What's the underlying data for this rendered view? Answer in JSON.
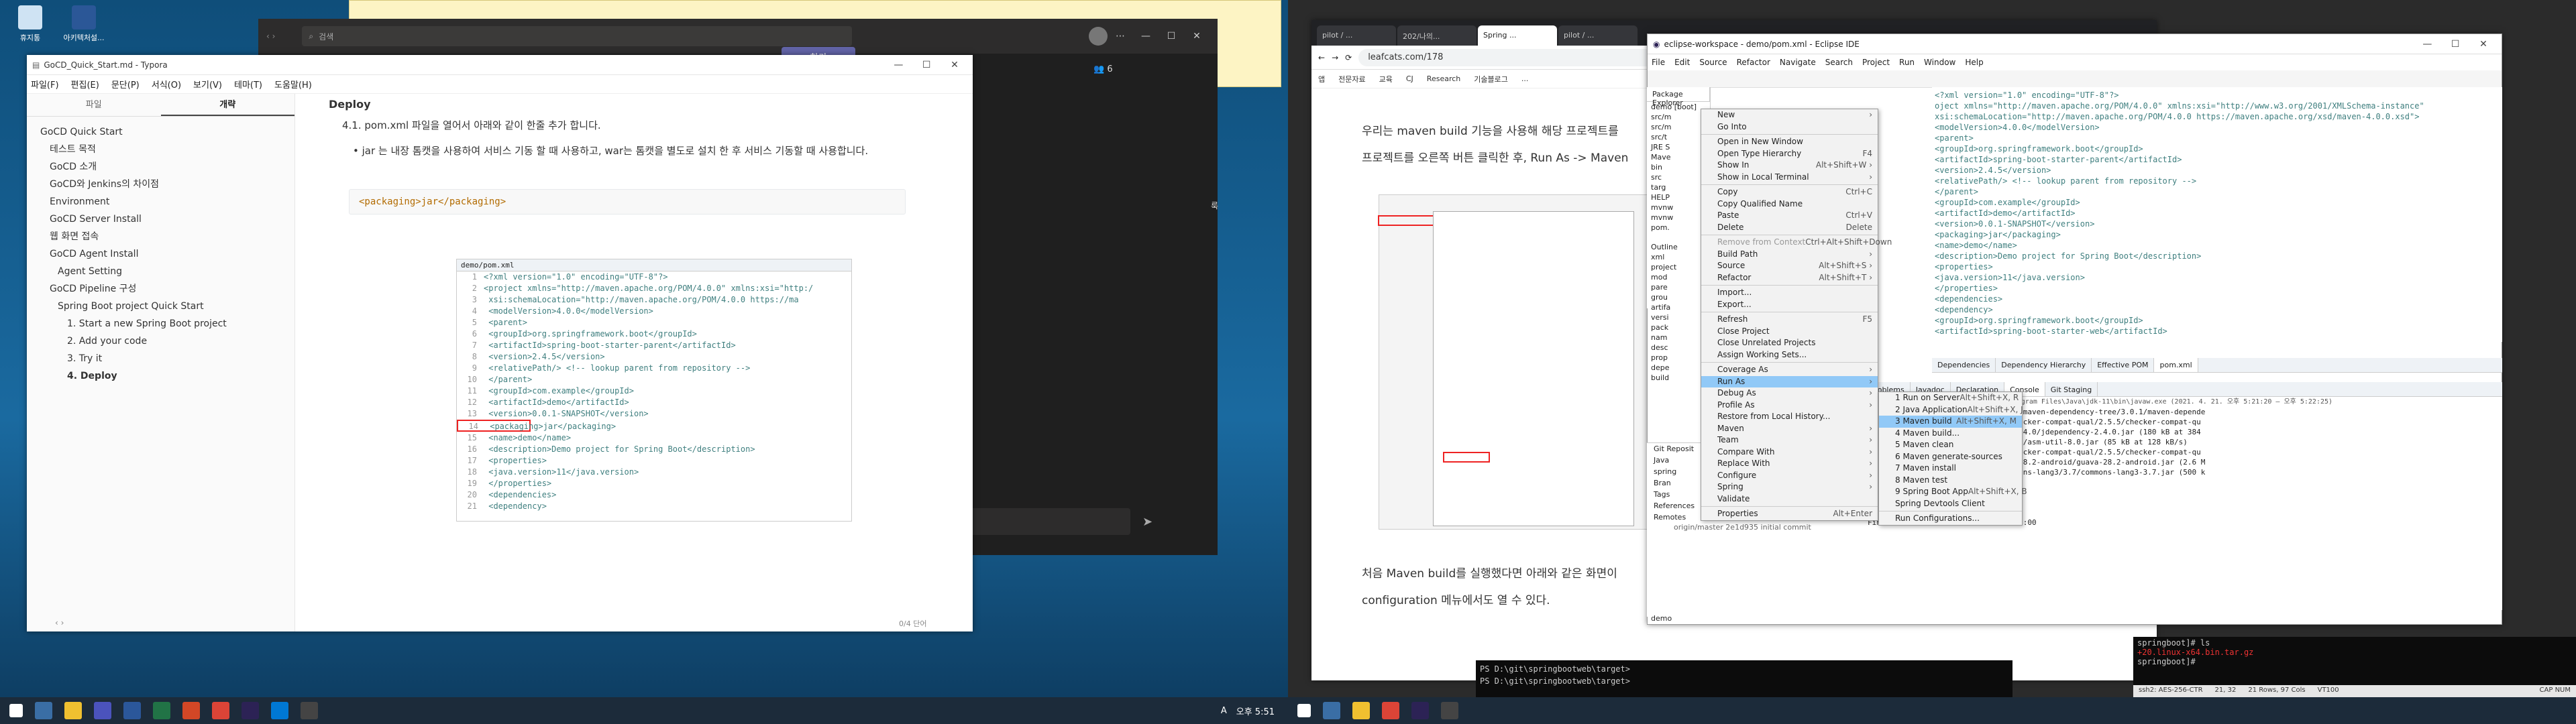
{
  "desktop_icons": [
    {
      "label": "휴지통",
      "icon": "recycle-bin-icon"
    },
    {
      "label": "아키텍처설...",
      "icon": "document-icon"
    }
  ],
  "chat_window": {
    "search_placeholder": "검색",
    "join_button": "참가",
    "participant_count": "6",
    "side_label": "룩"
  },
  "typora": {
    "title": "GoCD_Quick_Start.md - Typora",
    "menu": [
      "파일(F)",
      "편집(E)",
      "문단(P)",
      "서식(O)",
      "보기(V)",
      "테마(T)",
      "도움말(H)"
    ],
    "sidebar_tabs": [
      "파일",
      "개략"
    ],
    "toc": [
      {
        "text": "GoCD Quick Start",
        "level": 1
      },
      {
        "text": "테스트 목적",
        "level": 2
      },
      {
        "text": "GoCD 소개",
        "level": 2
      },
      {
        "text": "GoCD와 Jenkins의 차이점",
        "level": 2
      },
      {
        "text": "Environment",
        "level": 2
      },
      {
        "text": "GoCD Server Install",
        "level": 2
      },
      {
        "text": "웹 화면 접속",
        "level": 2
      },
      {
        "text": "GoCD Agent Install",
        "level": 2
      },
      {
        "text": "Agent Setting",
        "level": 3
      },
      {
        "text": "GoCD Pipeline 구성",
        "level": 2
      },
      {
        "text": "Spring Boot project Quick Start",
        "level": 3
      },
      {
        "text": "1. Start a new Spring Boot project",
        "level": 4
      },
      {
        "text": "2. Add your code",
        "level": 4
      },
      {
        "text": "3. Try it",
        "level": 4
      },
      {
        "text": "4. Deploy",
        "level": 4,
        "bold": true
      }
    ],
    "heading_partial": "Deploy",
    "step_text": "4.1. pom.xml 파일을 열어서 아래와 같이 한줄 추가 합니다.",
    "bullet": "jar 는 내장 톰캣을 사용하여 서비스 기동 할 때 사용하고, war는 톰캣을 별도로 설치 한 후 서비스 기동할 때 사용합니다.",
    "code": "<packaging>jar</packaging>",
    "screenshot_tab": "demo/pom.xml",
    "xml_lines": [
      {
        "n": "1",
        "t": "<?xml version=\"1.0\" encoding=\"UTF-8\"?>"
      },
      {
        "n": "2",
        "t": "<project xmlns=\"http://maven.apache.org/POM/4.0.0\" xmlns:xsi=\"http:/"
      },
      {
        "n": "3",
        "t": "    xsi:schemaLocation=\"http://maven.apache.org/POM/4.0.0 https://ma"
      },
      {
        "n": "4",
        "t": "    <modelVersion>4.0.0</modelVersion>"
      },
      {
        "n": "5",
        "t": "    <parent>"
      },
      {
        "n": "6",
        "t": "        <groupId>org.springframework.boot</groupId>"
      },
      {
        "n": "7",
        "t": "        <artifactId>spring-boot-starter-parent</artifactId>"
      },
      {
        "n": "8",
        "t": "        <version>2.4.5</version>"
      },
      {
        "n": "9",
        "t": "        <relativePath/> <!-- lookup parent from repository -->"
      },
      {
        "n": "10",
        "t": "    </parent>"
      },
      {
        "n": "11",
        "t": "    <groupId>com.example</groupId>"
      },
      {
        "n": "12",
        "t": "    <artifactId>demo</artifactId>"
      },
      {
        "n": "13",
        "t": "    <version>0.0.1-SNAPSHOT</version>"
      },
      {
        "n": "14",
        "t": "    <packaging>jar</packaging>"
      },
      {
        "n": "15",
        "t": "    <name>demo</name>"
      },
      {
        "n": "16",
        "t": "    <description>Demo project for Spring Boot</description>"
      },
      {
        "n": "17",
        "t": "    <properties>"
      },
      {
        "n": "18",
        "t": "        <java.version>11</java.version>"
      },
      {
        "n": "19",
        "t": "    </properties>"
      },
      {
        "n": "20",
        "t": "    <dependencies>"
      },
      {
        "n": "21",
        "t": "        <dependency>"
      }
    ],
    "status_words": "0/4 단어"
  },
  "chrome": {
    "tabs": [
      "pilot / ...",
      "202/나의...",
      "Spring ...",
      "pilot / ..."
    ],
    "url": "leafcats.com/178",
    "bookmarks": [
      "앱",
      "전문자료",
      "교육",
      "CJ",
      "Research",
      "기술블로그",
      "..."
    ],
    "para1": "우리는 maven build 기능을 사용해 해당 프로젝트를",
    "para2": "프로젝트를 오른쪽 버튼 클릭한 후, Run As -> Maven",
    "para3": "처음 Maven build를 실행했다면 아래와 같은 화면이",
    "para4": "configuration 메뉴에서도 열 수 있다."
  },
  "eclipse": {
    "title": "eclipse-workspace - demo/pom.xml - Eclipse IDE",
    "menu": [
      "File",
      "Edit",
      "Source",
      "Refactor",
      "Navigate",
      "Search",
      "Project",
      "Run",
      "Window",
      "Help"
    ],
    "explorer_title": "Package Explorer",
    "explorer_items": [
      "demo [boot]",
      "src/m",
      "src/m",
      "src/t",
      "JRE S",
      "Mave",
      "bin",
      "src",
      "targ",
      "HELP",
      "mvnw",
      "mvnw",
      "pom."
    ],
    "outline_items": [
      "Outline",
      "xml",
      "project",
      "mod",
      "pare",
      "grou",
      "artifa",
      "versi",
      "pack",
      "nam",
      "desc",
      "prop",
      "depe",
      "build"
    ],
    "editor_lines": [
      "<?xml version=\"1.0\" encoding=\"UTF-8\"?>",
      "oject xmlns=\"http://maven.apache.org/POM/4.0.0\" xmlns:xsi=\"http://www.w3.org/2001/XMLSchema-instance\"",
      "xsi:schemaLocation=\"http://maven.apache.org/POM/4.0.0 https://maven.apache.org/xsd/maven-4.0.0.xsd\">",
      "<modelVersion>4.0.0</modelVersion>",
      "<parent>",
      "    <groupId>org.springframework.boot</groupId>",
      "    <artifactId>spring-boot-starter-parent</artifactId>",
      "    <version>2.4.5</version>",
      "    <relativePath/> <!-- lookup parent from repository -->",
      "</parent>",
      "<groupId>com.example</groupId>",
      "<artifactId>demo</artifactId>",
      "<version>0.0.1-SNAPSHOT</version>",
      "<packaging>jar</packaging>",
      "<name>demo</name>",
      "<description>Demo project for Spring Boot</description>",
      "<properties>",
      "    <java.version>11</java.version>",
      "</properties>",
      "<dependencies>",
      "    <dependency>",
      "        <groupId>org.springframework.boot</groupId>",
      "        <artifactId>spring-boot-starter-web</artifactId>"
    ],
    "editor_tabs": [
      "Dependencies",
      "Dependency Hierarchy",
      "Effective POM",
      "pom.xml"
    ],
    "console_tabs": [
      "Problems",
      "Javadoc",
      "Declaration",
      "Console",
      "Git Staging"
    ],
    "console_header": "<terminated> demo [Maven Build] C:\\Program Files\\Java\\jdk-11\\bin\\javaw.exe (2021. 4. 21. 오후 5:21:20 – 오후 5:22:25)",
    "console_lines": [
      "org/maven2/org/apache/maven/shared/maven-dependency-tree/3.0.1/maven-depende",
      "org/maven2/org/checkerframework/checker-compat-qual/2.5.5/checker-compat-qu",
      "org/maven2/org/vafer/jdependency/2.4.0/jdependency-2.4.0.jar (180 kB at 384",
      "org/maven2/org/ow2/asm/asm-util/8.0/asm-util-8.0.jar (85 kB at 128 kB/s)",
      "org/maven2/org/checkerframework/checker-compat-qual/2.5.5/checker-compat-qu",
      "org/maven2/com/google/guava/guava/28.2-android/guava-28.2-android.jar (2.6 M",
      "org/maven2/org/apache/commons/commons-lang3/3.7/commons-lang3-3.7.jar (500 k",
      "",
      "LD SUCCESS",
      "",
      "Total time:  59.955 s",
      "Finished at: 2021-04-21T17:22:24+09:00"
    ],
    "bottom_items": [
      "Git Reposit",
      "Java",
      "spring",
      "Bran",
      "Tags",
      "References",
      "Remotes"
    ],
    "bottom_commit": "origin/master 2e1d935 initial commit",
    "status": "demo"
  },
  "context_menu": {
    "items": [
      {
        "label": "New",
        "sc": "›"
      },
      {
        "label": "Go Into",
        "sc": ""
      },
      {
        "sep": true
      },
      {
        "label": "Open in New Window",
        "sc": ""
      },
      {
        "label": "Open Type Hierarchy",
        "sc": "F4"
      },
      {
        "label": "Show In",
        "sc": "Alt+Shift+W ›"
      },
      {
        "label": "Show in Local Terminal",
        "sc": "›"
      },
      {
        "sep": true
      },
      {
        "label": "Copy",
        "sc": "Ctrl+C"
      },
      {
        "label": "Copy Qualified Name",
        "sc": ""
      },
      {
        "label": "Paste",
        "sc": "Ctrl+V"
      },
      {
        "label": "Delete",
        "sc": "Delete"
      },
      {
        "sep": true
      },
      {
        "label": "Remove from Context",
        "sc": "Ctrl+Alt+Shift+Down",
        "dis": true
      },
      {
        "label": "Build Path",
        "sc": "›"
      },
      {
        "label": "Source",
        "sc": "Alt+Shift+S ›"
      },
      {
        "label": "Refactor",
        "sc": "Alt+Shift+T ›"
      },
      {
        "sep": true
      },
      {
        "label": "Import...",
        "sc": ""
      },
      {
        "label": "Export...",
        "sc": ""
      },
      {
        "sep": true
      },
      {
        "label": "Refresh",
        "sc": "F5"
      },
      {
        "label": "Close Project",
        "sc": ""
      },
      {
        "label": "Close Unrelated Projects",
        "sc": ""
      },
      {
        "label": "Assign Working Sets...",
        "sc": ""
      },
      {
        "sep": true
      },
      {
        "label": "Coverage As",
        "sc": "›"
      },
      {
        "label": "Run As",
        "sc": "›",
        "sel": true
      },
      {
        "label": "Debug As",
        "sc": "›"
      },
      {
        "label": "Profile As",
        "sc": "›"
      },
      {
        "label": "Restore from Local History...",
        "sc": ""
      },
      {
        "label": "Maven",
        "sc": "›"
      },
      {
        "label": "Team",
        "sc": "›"
      },
      {
        "label": "Compare With",
        "sc": "›"
      },
      {
        "label": "Replace With",
        "sc": "›"
      },
      {
        "label": "Configure",
        "sc": "›"
      },
      {
        "label": "Spring",
        "sc": "›"
      },
      {
        "label": "Validate",
        "sc": ""
      },
      {
        "sep": true
      },
      {
        "label": "Properties",
        "sc": "Alt+Enter"
      }
    ]
  },
  "run_as_menu": {
    "items": [
      {
        "label": "1 Run on Server",
        "sc": "Alt+Shift+X, R"
      },
      {
        "label": "2 Java Application",
        "sc": "Alt+Shift+X, J"
      },
      {
        "label": "3 Maven build",
        "sc": "Alt+Shift+X, M",
        "sel": true
      },
      {
        "label": "4 Maven build...",
        "sc": ""
      },
      {
        "label": "5 Maven clean",
        "sc": ""
      },
      {
        "label": "6 Maven generate-sources",
        "sc": ""
      },
      {
        "label": "7 Maven install",
        "sc": ""
      },
      {
        "label": "8 Maven test",
        "sc": ""
      },
      {
        "label": "9 Spring Boot App",
        "sc": "Alt+Shift+X, B"
      },
      {
        "label": "Spring Devtools Client",
        "sc": ""
      },
      {
        "sep": true
      },
      {
        "label": "Run Configurations...",
        "sc": ""
      }
    ]
  },
  "terminal_left": [
    "PS D:\\git\\springbootweb\\target>",
    "PS D:\\git\\springbootweb\\target>"
  ],
  "terminal_right": [
    "springboot]# ls",
    "+20.linux-x64.bin.tar.gz",
    "springboot]# "
  ],
  "terminal_right_status": [
    "ssh2: AES-256-CTR",
    "21, 32",
    "21 Rows, 97 Cols",
    "VT100"
  ],
  "taskbar_left": {
    "time": "오후 5:51",
    "ime": "A"
  },
  "taskbar_right": {
    "status": "CAP NUM"
  }
}
